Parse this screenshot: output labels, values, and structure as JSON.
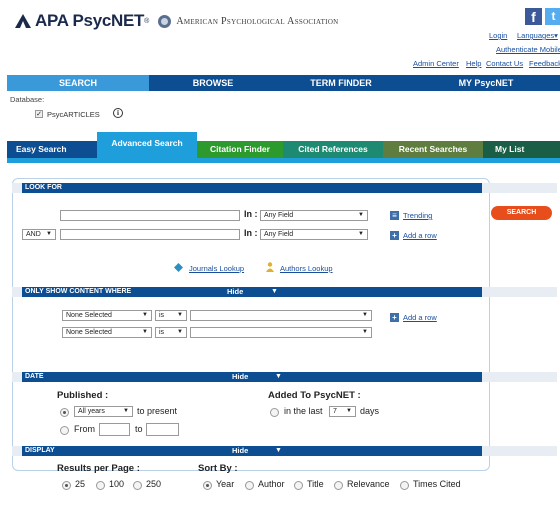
{
  "brand": {
    "product": "APA PsycNET",
    "registered": "®",
    "association": "American Psychological Association"
  },
  "social": {
    "facebook": "f",
    "twitter": "t"
  },
  "account_links": {
    "login": "Login",
    "languages": "Languages▾",
    "authenticate": "Authenticate Mobile",
    "admin_center": "Admin Center",
    "help": "Help",
    "contact_us": "Contact Us",
    "feedback": "Feedback"
  },
  "main_nav": {
    "search": "SEARCH",
    "browse": "BROWSE",
    "term_finder": "TERM FINDER",
    "my_psycnet": "MY PsycNET"
  },
  "database": {
    "label": "Database:",
    "name": "PsycARTICLES",
    "checked": true,
    "info_icon": "ⓘ"
  },
  "sub_tabs": {
    "easy": "Easy Search",
    "advanced": "Advanced Search",
    "citation": "Citation Finder",
    "cited": "Cited References",
    "recent": "Recent Searches",
    "my_list": "My List"
  },
  "look_for": {
    "header": "LOOK FOR",
    "row1": {
      "value": "",
      "in_label": "In :",
      "field": "Any Field"
    },
    "row2": {
      "operator": "AND",
      "value": "",
      "in_label": "In :",
      "field": "Any Field"
    },
    "trending": "Trending",
    "add_row": "Add a row",
    "journals_lookup": "Journals Lookup",
    "authors_lookup": "Authors Lookup",
    "search_button": "SEARCH"
  },
  "only_show": {
    "header": "ONLY SHOW CONTENT WHERE",
    "hide": "Hide",
    "rows": [
      {
        "field": "None Selected",
        "op": "is",
        "value": ""
      },
      {
        "field": "None Selected",
        "op": "is",
        "value": ""
      }
    ],
    "add_row": "Add a row"
  },
  "date": {
    "header": "DATE",
    "hide": "Hide",
    "published_label": "Published :",
    "all_years": "All years",
    "to_present": "to present",
    "from": "From",
    "to": "to",
    "added_label": "Added To PsycNET :",
    "in_the_last": "in the last",
    "days_value": "7",
    "days": "days"
  },
  "display": {
    "header": "DISPLAY",
    "hide": "Hide",
    "results_label": "Results per Page :",
    "results_options": [
      "25",
      "100",
      "250"
    ],
    "results_selected": "25",
    "sort_label": "Sort By :",
    "sort_options": [
      "Year",
      "Author",
      "Title",
      "Relevance",
      "Times Cited"
    ],
    "sort_selected": "Year"
  },
  "colors": {
    "nav_dark": "#0d4d91",
    "nav_active": "#3a9ad9",
    "tab_active": "#1e9fdb",
    "search_button": "#e84e1c"
  }
}
